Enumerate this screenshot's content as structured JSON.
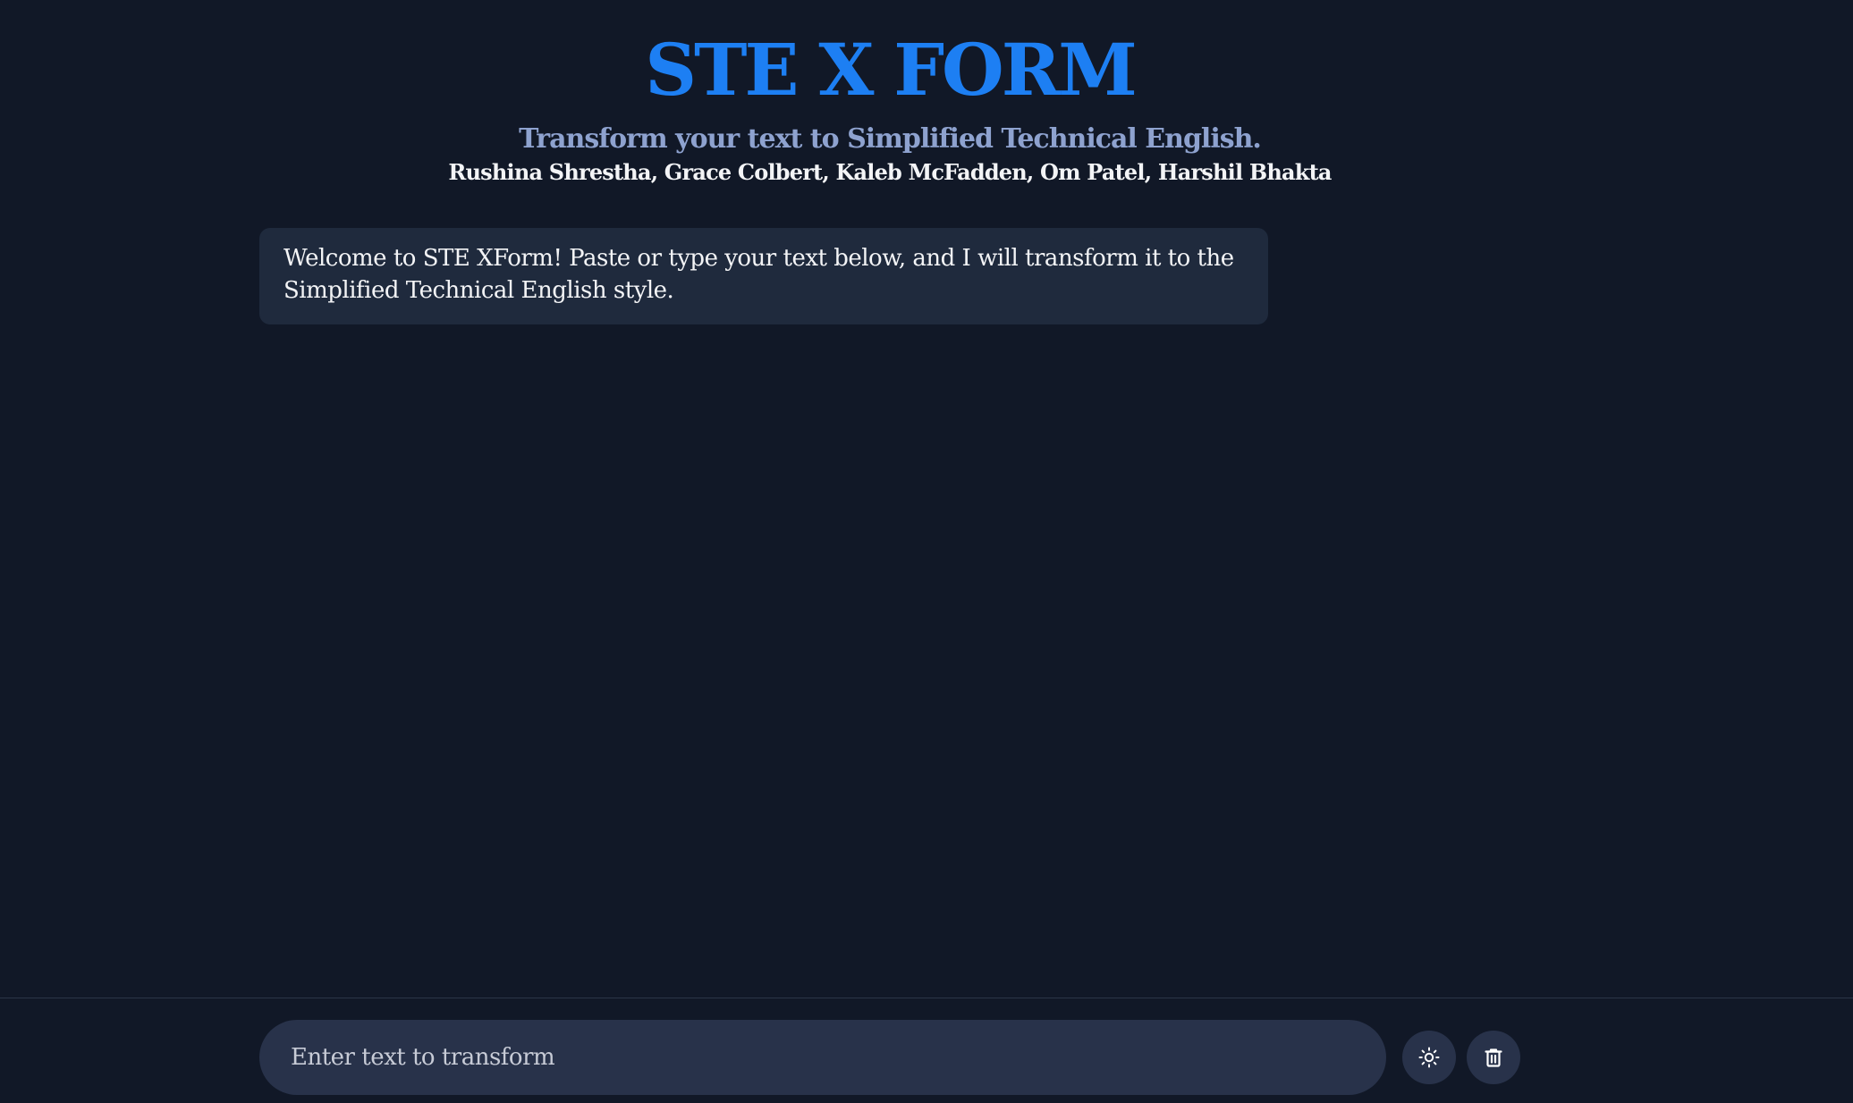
{
  "header": {
    "title": "STE X FORM",
    "subtitle": "Transform your text to Simplified Technical English.",
    "authors": "Rushina Shrestha, Grace Colbert, Kaleb McFadden, Om Patel, Harshil Bhakta"
  },
  "chat": {
    "messages": [
      {
        "role": "assistant",
        "text": "Welcome to STE XForm! Paste or type your text below, and I will transform it to the Simplified Technical English style."
      }
    ]
  },
  "composer": {
    "value": "",
    "placeholder": "Enter text to transform"
  },
  "controls": {
    "theme_icon": "sun-icon",
    "clear_icon": "trash-icon"
  },
  "colors": {
    "background": "#111827",
    "title": "#1d7ff3",
    "subtitle": "#8ea2cf",
    "message_bubble": "#1f2a3d",
    "input_background": "#28324a"
  }
}
